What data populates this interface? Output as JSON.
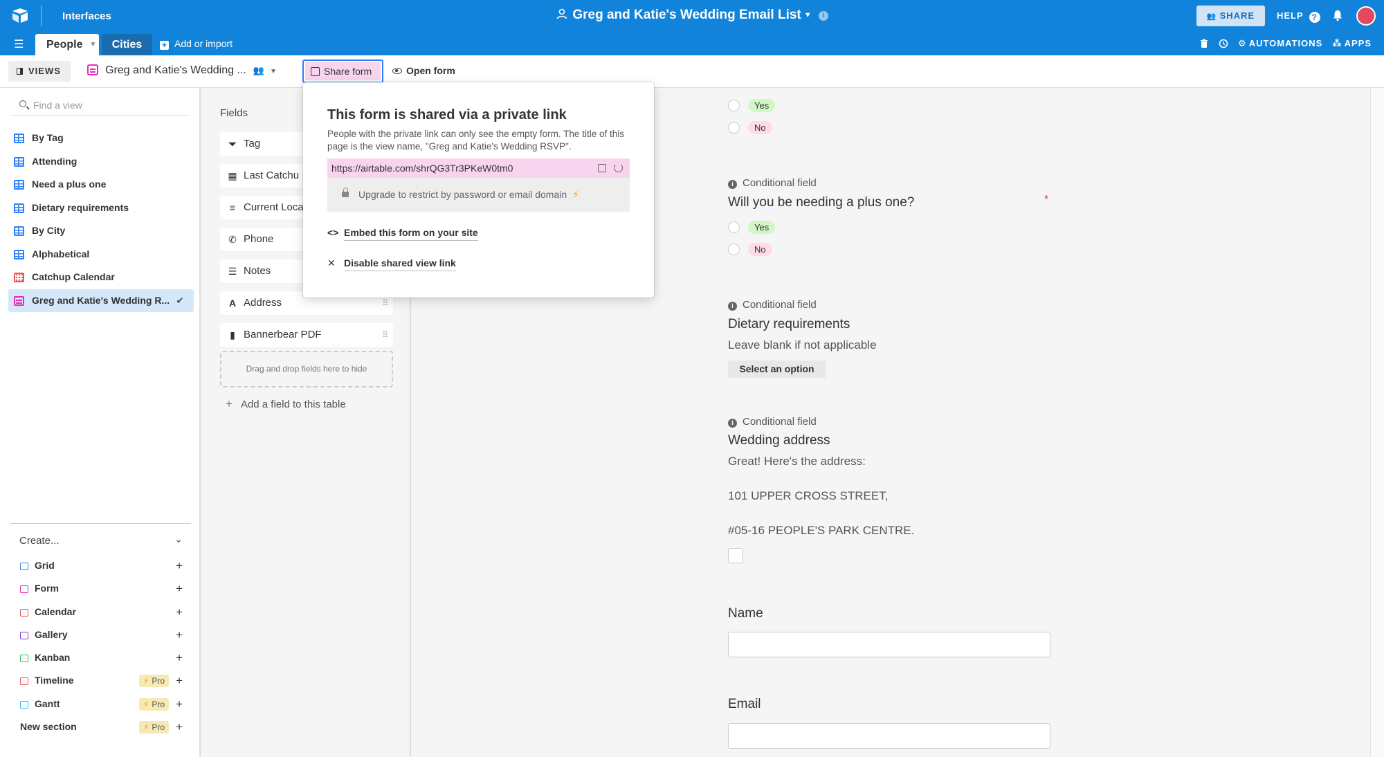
{
  "topbar": {
    "section": "Interfaces",
    "base_title": "Greg and Katie's Wedding Email List",
    "share": "SHARE",
    "help": "HELP",
    "colors": {
      "bar": "#1283da",
      "avatar": "#e4475f"
    }
  },
  "tabs": {
    "people": "People",
    "cities": "Cities",
    "add_import": "Add or import",
    "automations": "AUTOMATIONS",
    "apps": "APPS"
  },
  "viewbar": {
    "views": "VIEWS",
    "current_view": "Greg and Katie's Wedding ...",
    "share_form": "Share form",
    "open_form": "Open form"
  },
  "sidebar": {
    "find_placeholder": "Find a view",
    "views": [
      {
        "label": "By Tag",
        "icon": "grid-icon"
      },
      {
        "label": "Attending",
        "icon": "grid-icon"
      },
      {
        "label": "Need a plus one",
        "icon": "grid-icon"
      },
      {
        "label": "Dietary requirements",
        "icon": "grid-icon"
      },
      {
        "label": "By City",
        "icon": "grid-icon"
      },
      {
        "label": "Alphabetical",
        "icon": "grid-icon"
      },
      {
        "label": "Catchup Calendar",
        "icon": "calendar-icon"
      },
      {
        "label": "Greg and Katie's Wedding R...",
        "icon": "form-icon",
        "active": true
      }
    ],
    "create_label": "Create...",
    "create": [
      {
        "label": "Grid",
        "color": "#2d7ff9"
      },
      {
        "label": "Form",
        "color": "#e929ba"
      },
      {
        "label": "Calendar",
        "color": "#f0544f"
      },
      {
        "label": "Gallery",
        "color": "#7c39ed"
      },
      {
        "label": "Kanban",
        "color": "#20c933"
      },
      {
        "label": "Timeline",
        "color": "#f0544f",
        "pro": "Pro"
      },
      {
        "label": "Gantt",
        "color": "#18bfff",
        "pro": "Pro"
      },
      {
        "label": "New section",
        "pro": "Pro"
      }
    ]
  },
  "fields": {
    "label": "Fields",
    "items": [
      {
        "label": "Tag",
        "icon": "single-select-icon"
      },
      {
        "label": "Last Catchu",
        "icon": "date-icon"
      },
      {
        "label": "Current Loca",
        "icon": "long-text-icon"
      },
      {
        "label": "Phone",
        "icon": "phone-icon"
      },
      {
        "label": "Notes",
        "icon": "notes-icon"
      },
      {
        "label": "Address",
        "icon": "text-icon"
      },
      {
        "label": "Bannerbear PDF",
        "icon": "attachment-icon"
      }
    ],
    "drop_zone": "Drag and drop fields here to hide",
    "add_field": "Add a field to this table"
  },
  "popover": {
    "title": "This form is shared via a private link",
    "description": "People with the private link can only see the empty form. The title of this page is the view name, \"Greg and Katie's Wedding RSVP\".",
    "link": "https://airtable.com/shrQG3Tr3PKeW0tm0",
    "upgrade": "Upgrade to restrict by password or email domain",
    "embed": "Embed this form on your site",
    "disable": "Disable shared view link"
  },
  "form": {
    "yes": "Yes",
    "no": "No",
    "conditional": "Conditional field",
    "plus_one_question": "Will you be needing a plus one?",
    "dietary_question": "Dietary requirements",
    "dietary_desc": "Leave blank if not applicable",
    "select_option": "Select an option",
    "address_question": "Wedding address",
    "address_line1": "Great! Here's the address:",
    "address_line2": "101 UPPER CROSS STREET,",
    "address_line3": "#05-16 PEOPLE'S PARK CENTRE.",
    "name_label": "Name",
    "email_label": "Email"
  }
}
